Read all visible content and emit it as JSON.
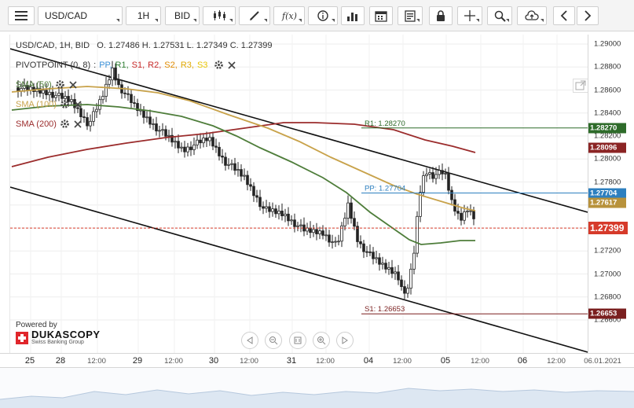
{
  "toolbar": {
    "symbol": "USD/CAD",
    "timeframe": "1H",
    "price_side": "BID"
  },
  "legend": {
    "ohlc": "USD/CAD, 1H, BID   O. 1.27486 H. 1.27531 L. 1.27349 C. 1.27399",
    "pivot_name": "PIVOTPOINT (0, 8)",
    "pivot_items": [
      {
        "label": "PP,",
        "color": "#3a8fd6"
      },
      {
        "label": "R1,",
        "color": "#2e7d32"
      },
      {
        "label": "S1,",
        "color": "#c62828"
      },
      {
        "label": "R2,",
        "color": "#c62828"
      },
      {
        "label": "S2,",
        "color": "#e08a00"
      },
      {
        "label": "R3,",
        "color": "#e0a800"
      },
      {
        "label": "S3",
        "color": "#e8c400"
      }
    ],
    "sma": [
      {
        "label": "SMA (50)",
        "color": "#4e7d3a"
      },
      {
        "label": "SMA (100)",
        "color": "#c8a24a"
      },
      {
        "label": "SMA (200)",
        "color": "#9b2c2c"
      }
    ]
  },
  "price_axis": {
    "ticks": [
      "1.29000",
      "1.28800",
      "1.28600",
      "1.28400",
      "1.28200",
      "1.28000",
      "1.27800",
      "1.27600",
      "1.27400",
      "1.27200",
      "1.27000",
      "1.26800",
      "1.26600"
    ],
    "labels": [
      {
        "text": "1.28270",
        "color": "#2e6b2a",
        "price": 1.2827
      },
      {
        "text": "1.28096",
        "color": "#8b2424",
        "price": 1.28096
      },
      {
        "text": "1.27704",
        "color": "#2d7fbf",
        "price": 1.27704
      },
      {
        "text": "1.27617",
        "color": "#b8923b",
        "price": 1.27617
      },
      {
        "text": "1.27399",
        "color": "#d63a2a",
        "price": 1.27399
      },
      {
        "text": "1.26653",
        "color": "#7a1f1f",
        "price": 1.26653
      }
    ]
  },
  "lines": {
    "r1": "R1: 1.28270",
    "pp": "PP: 1.27704",
    "s1": "S1: 1.26653"
  },
  "time_axis": [
    {
      "text": "25",
      "small": false
    },
    {
      "text": "28",
      "small": false
    },
    {
      "text": "12:00",
      "small": true
    },
    {
      "text": "29",
      "small": false
    },
    {
      "text": "12:00",
      "small": true
    },
    {
      "text": "30",
      "small": false
    },
    {
      "text": "12:00",
      "small": true
    },
    {
      "text": "31",
      "small": false
    },
    {
      "text": "12:00",
      "small": true
    },
    {
      "text": "04",
      "small": false
    },
    {
      "text": "12:00",
      "small": true
    },
    {
      "text": "05",
      "small": false
    },
    {
      "text": "12:00",
      "small": true
    },
    {
      "text": "06",
      "small": false
    },
    {
      "text": "12:00",
      "small": true
    },
    {
      "text": "06.01.2021",
      "small": true
    }
  ],
  "branding": {
    "powered": "Powered by",
    "name": "DUKASCOPY",
    "sub": "Swiss Banking Group"
  }
}
